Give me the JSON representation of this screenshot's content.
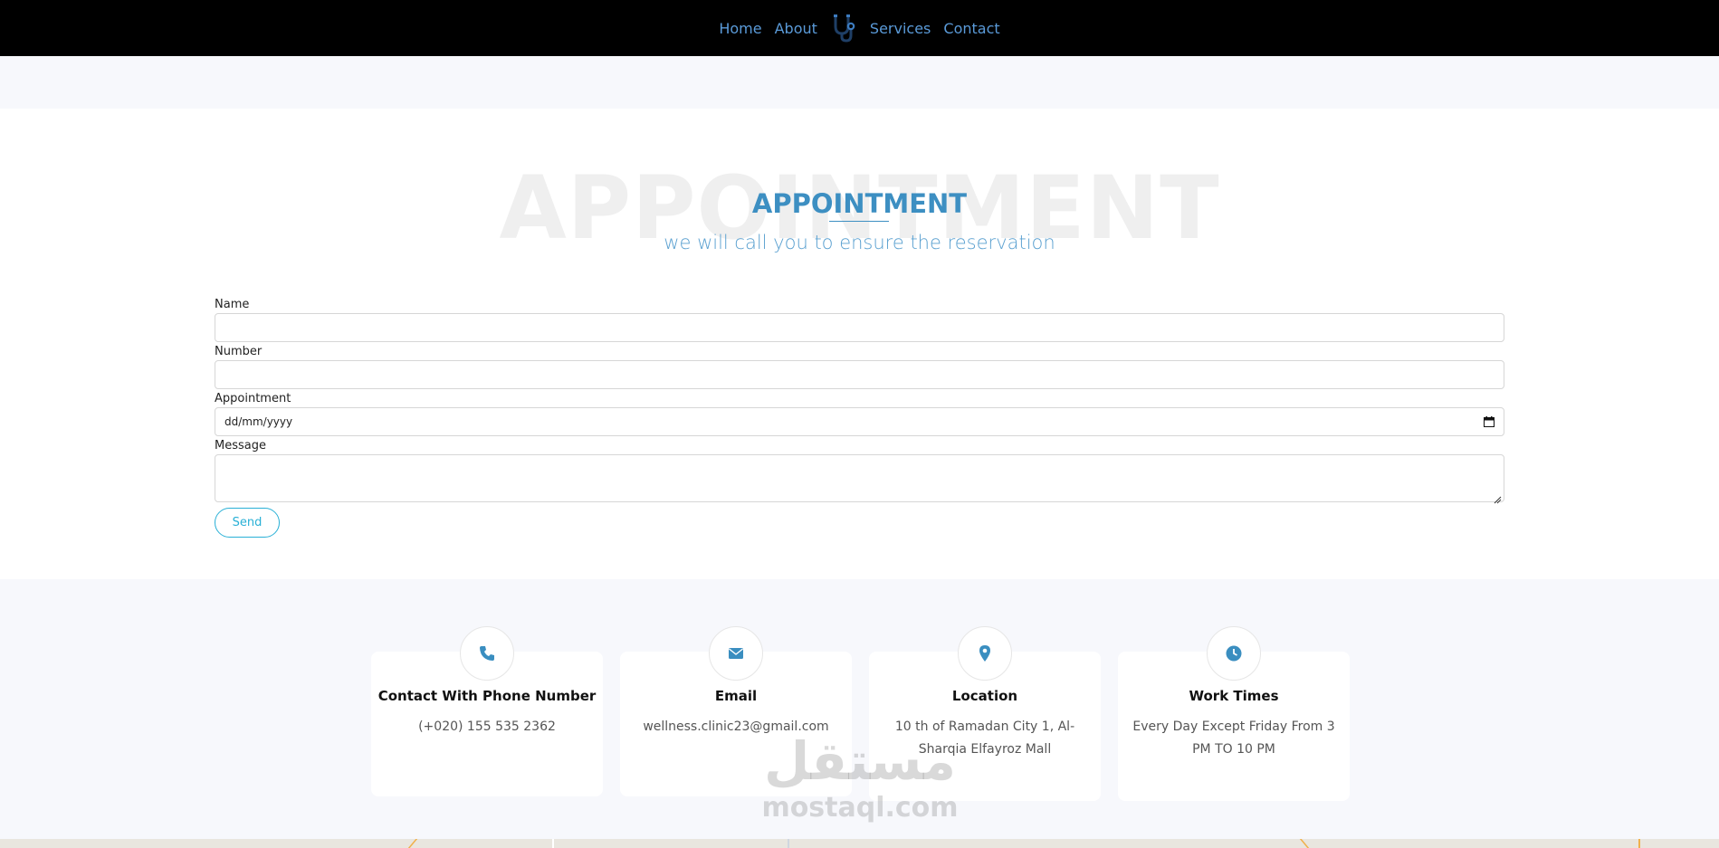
{
  "nav": {
    "links": [
      "Home",
      "About",
      "Services",
      "Contact"
    ],
    "logo_icon": "stethoscope-icon",
    "link_color": "#5a9ad8"
  },
  "appointment": {
    "background_word": "APPOINTMENT",
    "title": "APPOINTMENT",
    "subtitle": "we will call you to ensure the reservation",
    "accent_color": "#3d8fc2"
  },
  "form": {
    "name_label": "Name",
    "name_value": "",
    "number_label": "Number",
    "number_value": "",
    "appointment_label": "Appointment",
    "appointment_placeholder": "dd/mm/yyyy",
    "message_label": "Message",
    "message_value": "",
    "send_label": "Send",
    "send_color": "#29b0d6"
  },
  "contact": {
    "cards": [
      {
        "icon": "phone-icon",
        "title": "Contact With Phone Number",
        "text": "(+020) 155 535 2362"
      },
      {
        "icon": "envelope-icon",
        "title": "Email",
        "text": "wellness.clinic23@gmail.com"
      },
      {
        "icon": "map-pin-icon",
        "title": "Location",
        "text": "10 th of Ramadan City 1, Al-Sharqia Elfayroz Mall"
      },
      {
        "icon": "clock-icon",
        "title": "Work Times",
        "text": "Every Day Except Friday From 3 PM TO 10 PM"
      }
    ]
  },
  "watermark": {
    "arabic": "مستقل",
    "latin": "mostaql.com"
  }
}
